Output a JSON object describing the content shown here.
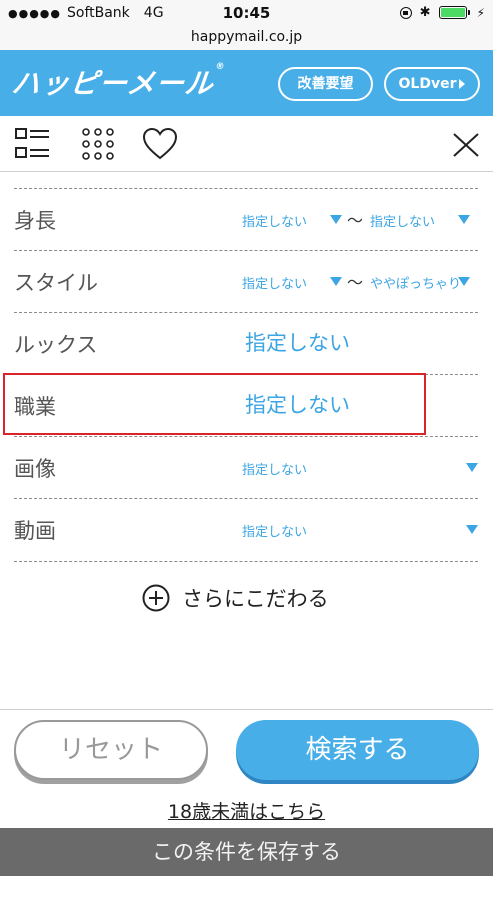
{
  "status_bar": {
    "signal": "●●●●●",
    "carrier": "SoftBank",
    "network": "4G",
    "time": "10:45"
  },
  "url": "happymail.co.jp",
  "header": {
    "logo_text": "ハッピーメール",
    "registered_mark": "®",
    "btn_kaizen": "改善要望",
    "btn_old": "OLDver"
  },
  "rows": [
    {
      "label": "身長",
      "from": "指定しない",
      "tilde": "〜",
      "to": "指定しない"
    },
    {
      "label": "スタイル",
      "from": "指定しない",
      "tilde": "〜",
      "to": "ややぽっちゃり"
    },
    {
      "label": "ルックス",
      "value": "指定しない"
    },
    {
      "label": "職業",
      "value": "指定しない"
    },
    {
      "label": "画像",
      "value": "指定しない"
    },
    {
      "label": "動画",
      "value": "指定しない"
    }
  ],
  "more_label": "さらにこだわる",
  "buttons": {
    "reset": "リセット",
    "search": "検索する"
  },
  "under18_link": "18歳未満はこちら",
  "save_bar": "この条件を保存する",
  "colors": {
    "brand_blue": "#47aee8",
    "select_blue": "#3ca5e3",
    "highlight_red": "#d9242a",
    "save_bar_gray": "#6a6a6a"
  }
}
